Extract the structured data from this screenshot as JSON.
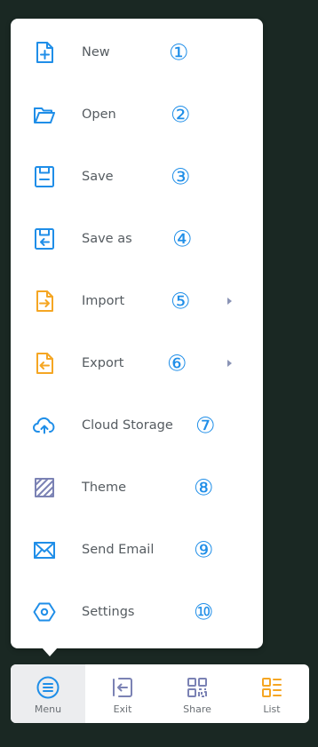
{
  "menu": {
    "items": [
      {
        "label": "New",
        "badge": "①",
        "icon": "new-file-icon",
        "submenu": false
      },
      {
        "label": "Open",
        "badge": "②",
        "icon": "open-folder-icon",
        "submenu": false
      },
      {
        "label": "Save",
        "badge": "③",
        "icon": "save-icon",
        "submenu": false
      },
      {
        "label": "Save as",
        "badge": "④",
        "icon": "save-as-icon",
        "submenu": false
      },
      {
        "label": "Import",
        "badge": "⑤",
        "icon": "import-icon",
        "submenu": true
      },
      {
        "label": "Export",
        "badge": "⑥",
        "icon": "export-icon",
        "submenu": true
      },
      {
        "label": "Cloud Storage",
        "badge": "⑦",
        "icon": "cloud-upload-icon",
        "submenu": false
      },
      {
        "label": "Theme",
        "badge": "⑧",
        "icon": "theme-pattern-icon",
        "submenu": false
      },
      {
        "label": "Send Email",
        "badge": "⑨",
        "icon": "envelope-icon",
        "submenu": false
      },
      {
        "label": "Settings",
        "badge": "⑩",
        "icon": "settings-hexagon-icon",
        "submenu": false
      }
    ]
  },
  "toolbar": {
    "items": [
      {
        "label": "Menu",
        "icon": "menu-circle-icon",
        "active": true
      },
      {
        "label": "Exit",
        "icon": "exit-arrow-icon",
        "active": false
      },
      {
        "label": "Share",
        "icon": "qr-code-icon",
        "active": false
      },
      {
        "label": "List",
        "icon": "list-icon",
        "active": false
      }
    ]
  },
  "colors": {
    "blue_icon": "#1f8ee8",
    "orange_icon": "#f5a623",
    "purple_icon": "#7b82b4",
    "background": "#1a2823",
    "badge": "#1f8ee8"
  }
}
